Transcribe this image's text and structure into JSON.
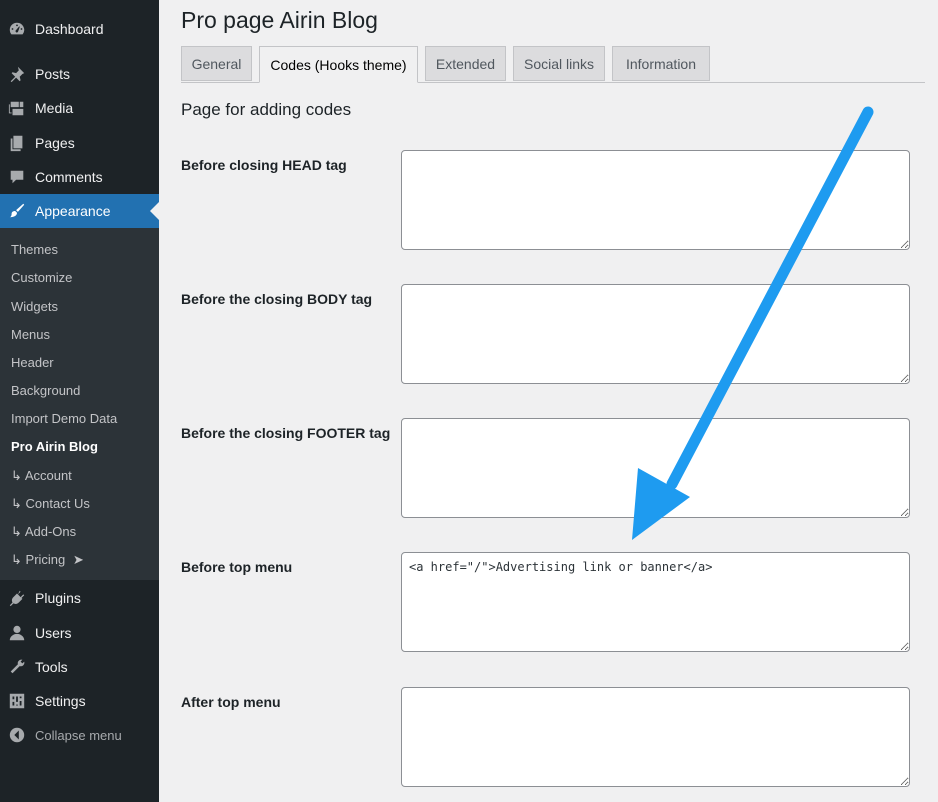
{
  "sidebar": {
    "dashboard": "Dashboard",
    "posts": "Posts",
    "media": "Media",
    "pages": "Pages",
    "comments": "Comments",
    "appearance": "Appearance",
    "submenu": {
      "themes": "Themes",
      "customize": "Customize",
      "widgets": "Widgets",
      "menus": "Menus",
      "header": "Header",
      "background": "Background",
      "import_demo": "Import Demo Data",
      "pro_airin": "Pro Airin Blog",
      "account": "Account",
      "contact": "Contact Us",
      "addons": "Add-Ons",
      "pricing": "Pricing",
      "child_prefix": "↳",
      "pricing_arrow": "➤"
    },
    "plugins": "Plugins",
    "users": "Users",
    "tools": "Tools",
    "settings": "Settings",
    "collapse": "Collapse menu"
  },
  "page": {
    "title": "Pro page Airin Blog",
    "section_title": "Page for adding codes",
    "tabs": [
      "General",
      "Codes (Hooks theme)",
      "Extended",
      "Social links",
      "Information"
    ],
    "active_tab": "Codes (Hooks theme)"
  },
  "fields": [
    {
      "label": "Before closing HEAD tag",
      "value": ""
    },
    {
      "label": "Before the closing BODY tag",
      "value": ""
    },
    {
      "label": "Before the closing FOOTER tag",
      "value": ""
    },
    {
      "label": "Before top menu",
      "value": "<a href=\"/\">Advertising link or banner</a>"
    },
    {
      "label": "After top menu",
      "value": ""
    }
  ],
  "colors": {
    "sidebar_bg": "#1d2327",
    "submenu_bg": "#2c3338",
    "accent": "#2271b1",
    "annotation_arrow": "#1e9bf0"
  }
}
